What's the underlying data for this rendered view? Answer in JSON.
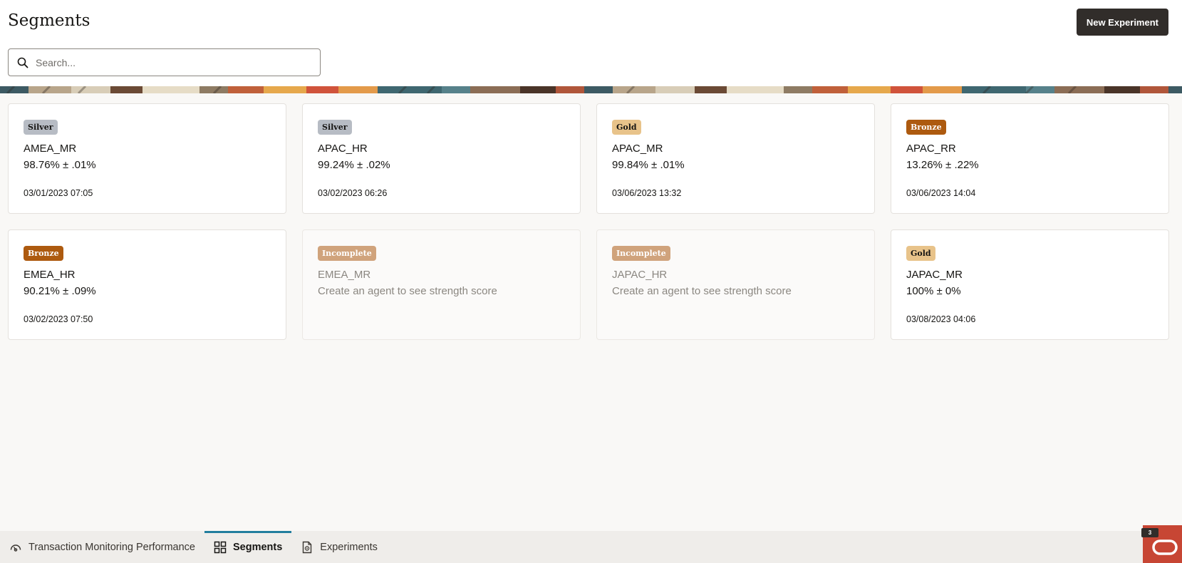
{
  "header": {
    "title": "Segments",
    "new_experiment_label": "New Experiment"
  },
  "search": {
    "placeholder": "Search...",
    "value": ""
  },
  "colors": {
    "badge_silver": "#b7bcc4",
    "badge_gold": "#e8c38a",
    "badge_bronze": "#ad5a0f",
    "badge_incomplete": "#d0a37c",
    "active_tab": "#227e9e",
    "brand": "#c74634"
  },
  "cards": [
    {
      "badge": "Silver",
      "tier": "silver",
      "name": "AMEA_MR",
      "score": "98.76% ± .01%",
      "date": "03/01/2023 07:05"
    },
    {
      "badge": "Silver",
      "tier": "silver",
      "name": "APAC_HR",
      "score": "99.24% ± .02%",
      "date": "03/02/2023 06:26"
    },
    {
      "badge": "Gold",
      "tier": "gold",
      "name": "APAC_MR",
      "score": "99.84% ± .01%",
      "date": "03/06/2023 13:32"
    },
    {
      "badge": "Bronze",
      "tier": "bronze",
      "name": "APAC_RR",
      "score": "13.26% ± .22%",
      "date": "03/06/2023 14:04"
    },
    {
      "badge": "Bronze",
      "tier": "bronze",
      "name": "EMEA_HR",
      "score": "90.21% ± .09%",
      "date": "03/02/2023 07:50"
    },
    {
      "badge": "Incomplete",
      "tier": "incomplete",
      "name": "EMEA_MR",
      "score": "Create an agent to see strength score",
      "date": ""
    },
    {
      "badge": "Incomplete",
      "tier": "incomplete",
      "name": "JAPAC_HR",
      "score": "Create an agent to see strength score",
      "date": ""
    },
    {
      "badge": "Gold",
      "tier": "gold",
      "name": "JAPAC_MR",
      "score": "100% ± 0%",
      "date": "03/08/2023 04:06"
    }
  ],
  "bottom_nav": {
    "tabs": [
      {
        "label": "Transaction Monitoring Performance",
        "icon": "gauge-icon",
        "active": false
      },
      {
        "label": "Segments",
        "icon": "grid-icon",
        "active": true
      },
      {
        "label": "Experiments",
        "icon": "document-icon",
        "active": false
      }
    ]
  },
  "corner": {
    "count": "3",
    "logo": "oracle-logo-icon"
  }
}
